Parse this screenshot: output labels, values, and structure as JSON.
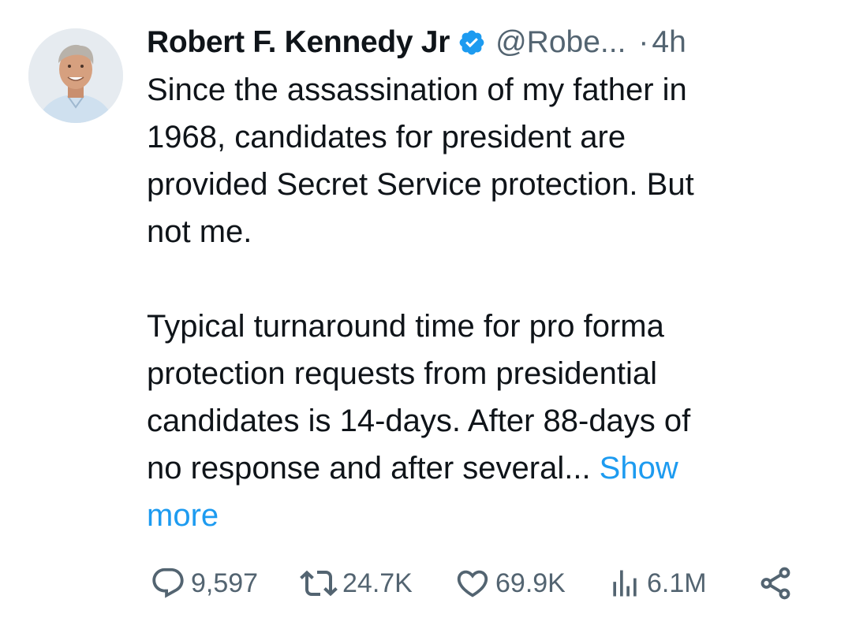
{
  "tweet": {
    "author": {
      "display_name": "Robert F. Kennedy Jr",
      "handle": "@Robe...",
      "verified_icon": "verified-badge-icon"
    },
    "separator": "·",
    "time": "4h",
    "text": {
      "paragraph1": "Since the assassination of my father in\n1968, candidates for president are\nprovided Secret Service protection.  But\nnot me.",
      "paragraph2": "Typical turnaround time for pro forma\nprotection requests from presidential\ncandidates is 14-days.  After 88-days of\nno response and after several... ",
      "show_more": "Show\nmore"
    },
    "actions": {
      "replies": "9,597",
      "retweets": "24.7K",
      "likes": "69.9K",
      "views": "6.1M"
    },
    "colors": {
      "text": "#0f1419",
      "secondary": "#536471",
      "accent": "#1d9bf0"
    }
  }
}
